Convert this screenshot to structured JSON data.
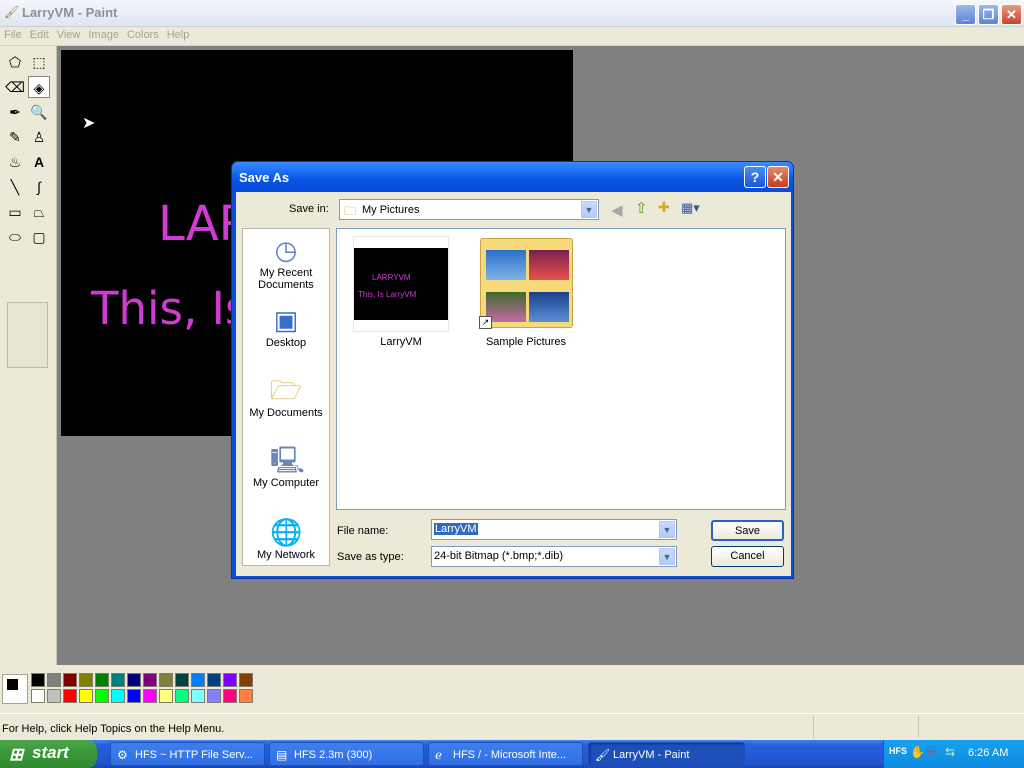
{
  "window": {
    "title": "LarryVM - Paint",
    "icon": "paint-icon"
  },
  "menu": [
    "File",
    "Edit",
    "View",
    "Image",
    "Colors",
    "Help"
  ],
  "canvas": {
    "line1": "LARRYVM",
    "line2": "This, Is LarryVM",
    "text_color": "#d23ad6",
    "bg": "#000000"
  },
  "palette": {
    "row1": [
      "#000000",
      "#808080",
      "#800000",
      "#808000",
      "#008000",
      "#008080",
      "#000080",
      "#800080",
      "#808040",
      "#004040",
      "#0080ff",
      "#004080",
      "#8000ff",
      "#804000"
    ],
    "row2": [
      "#ffffff",
      "#c0c0c0",
      "#ff0000",
      "#ffff00",
      "#00ff00",
      "#00ffff",
      "#0000ff",
      "#ff00ff",
      "#ffff80",
      "#00ff80",
      "#80ffff",
      "#8080ff",
      "#ff0080",
      "#ff8040"
    ]
  },
  "status": "For Help, click Help Topics on the Help Menu.",
  "dialog": {
    "title": "Save As",
    "save_in_label": "Save in:",
    "save_in_value": "My Pictures",
    "places": [
      "My Recent Documents",
      "Desktop",
      "My Documents",
      "My Computer",
      "My Network"
    ],
    "files": [
      {
        "name": "LarryVM",
        "thumb_line1": "LARRYVM",
        "thumb_line2": "This, Is LarryVM"
      },
      {
        "name": "Sample Pictures"
      }
    ],
    "file_name_label": "File name:",
    "file_name_value": "LarryVM",
    "save_type_label": "Save as type:",
    "save_type_value": "24-bit Bitmap (*.bmp;*.dib)",
    "save_button": "Save",
    "cancel_button": "Cancel"
  },
  "taskbar": {
    "start": "start",
    "tasks": [
      "HFS ~ HTTP File Serv...",
      "HFS 2.3m (300)",
      "HFS / - Microsoft Inte...",
      "LarryVM - Paint"
    ],
    "clock": "6:26 AM"
  }
}
